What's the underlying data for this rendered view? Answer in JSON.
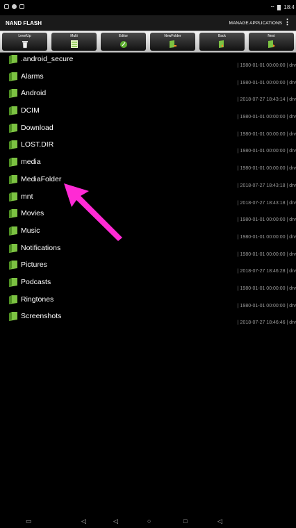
{
  "status_bar": {
    "time": "18:4"
  },
  "app_bar": {
    "title": "NAND FLASH",
    "manage_label": "MANAGE APPLICATIONS",
    "overflow_label": "⋮"
  },
  "toolbar": [
    {
      "label": "LevelUp",
      "icon": "trash-icon"
    },
    {
      "label": "Multi",
      "icon": "list-icon"
    },
    {
      "label": "Editor",
      "icon": "editor-icon"
    },
    {
      "label": "NewFolder",
      "icon": "new-folder-icon"
    },
    {
      "label": "Back",
      "icon": "back-folder-icon"
    },
    {
      "label": "Next",
      "icon": "next-folder-icon"
    }
  ],
  "files": [
    {
      "name": ".android_secure",
      "meta": "| 1980-01-01 00:00:00 | drv"
    },
    {
      "name": "Alarms",
      "meta": "| 1980-01-01 00:00:00 | drv"
    },
    {
      "name": "Android",
      "meta": "| 2018-07-27 18:43:14 | drv"
    },
    {
      "name": "DCIM",
      "meta": "| 1980-01-01 00:00:00 | drv"
    },
    {
      "name": "Download",
      "meta": "| 1980-01-01 00:00:00 | drv"
    },
    {
      "name": "LOST.DIR",
      "meta": "| 1980-01-01 00:00:00 | drv"
    },
    {
      "name": "media",
      "meta": "| 1980-01-01 00:00:00 | drv"
    },
    {
      "name": "MediaFolder",
      "meta": "| 2018-07-27 18:43:18 | drv"
    },
    {
      "name": "mnt",
      "meta": "| 2018-07-27 18:43:18 | drv"
    },
    {
      "name": "Movies",
      "meta": "| 1980-01-01 00:00:00 | drv"
    },
    {
      "name": "Music",
      "meta": "| 1980-01-01 00:00:00 | drv"
    },
    {
      "name": "Notifications",
      "meta": "| 1980-01-01 00:00:00 | drv"
    },
    {
      "name": "Pictures",
      "meta": "| 2018-07-27 18:46:28 | drv"
    },
    {
      "name": "Podcasts",
      "meta": "| 1980-01-01 00:00:00 | drv"
    },
    {
      "name": "Ringtones",
      "meta": "| 1980-01-01 00:00:00 | drv"
    },
    {
      "name": "Screenshots",
      "meta": "| 2018-07-27 18:46:46 | drv"
    }
  ],
  "nav_bar": {
    "icons": [
      "screenshot-icon",
      "volume-down-icon",
      "back-icon",
      "home-icon",
      "recents-icon",
      "volume-up-icon"
    ]
  },
  "colors": {
    "folder_green": "#7cc242",
    "annotation_arrow": "#ff2ad4",
    "meta_text": "#9a9a9a"
  }
}
